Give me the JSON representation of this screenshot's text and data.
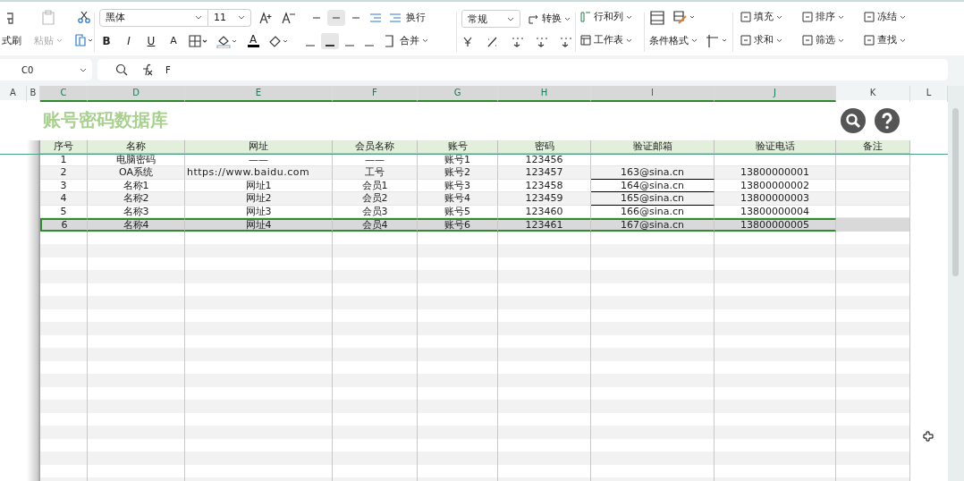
{
  "ribbon": {
    "clipboard": {
      "format_painter": "式刷",
      "paste": "粘贴"
    },
    "font": {
      "family": "黑体",
      "size": "11",
      "bold": "B",
      "italic": "I",
      "underline": "U",
      "strike": "A",
      "font_color": "A"
    },
    "alignment": {
      "wrap": "换行",
      "merge": "合并"
    },
    "number": {
      "format": "常规",
      "convert": "转换"
    },
    "cells": {
      "rows_cols": "行和列",
      "sheet": "工作表",
      "conditional": "条件格式"
    },
    "editing": [
      {
        "label": "填充"
      },
      {
        "label": "排序"
      },
      {
        "label": "冻结"
      },
      {
        "label": "求和"
      },
      {
        "label": "筛选"
      },
      {
        "label": "查找"
      }
    ]
  },
  "formula_bar": {
    "cell_ref": "C0",
    "formula": "F"
  },
  "column_headers": [
    {
      "label": "A",
      "selected": false
    },
    {
      "label": "B",
      "selected": false
    },
    {
      "label": "C",
      "selected": true
    },
    {
      "label": "D",
      "selected": true
    },
    {
      "label": "E",
      "selected": true
    },
    {
      "label": "F",
      "selected": true
    },
    {
      "label": "G",
      "selected": true
    },
    {
      "label": "H",
      "selected": true
    },
    {
      "label": "I",
      "selected": true
    },
    {
      "label": "J",
      "selected": true
    },
    {
      "label": "K",
      "selected": false
    },
    {
      "label": "L",
      "selected": false
    }
  ],
  "sheet_title": "账号密码数据库",
  "table": {
    "columns": [
      {
        "label": "序号"
      },
      {
        "label": "名称"
      },
      {
        "label": "网址"
      },
      {
        "label": "会员名称"
      },
      {
        "label": "账号"
      },
      {
        "label": "密码"
      },
      {
        "label": "验证邮箱"
      },
      {
        "label": "验证电话"
      },
      {
        "label": "备注"
      }
    ],
    "rows": [
      {
        "no": "1",
        "name": "电脑密码",
        "url": "——",
        "member": "——",
        "account": "账号1",
        "password": "123456",
        "email_underlined": false,
        "selected": false
      },
      {
        "no": "2",
        "name": "OA系统",
        "url": "https://www.baidu.com",
        "member": "工号",
        "account": "账号2",
        "password": "123457",
        "email": "163@sina.cn",
        "phone": "13800000001",
        "email_underlined": true,
        "selected": false
      },
      {
        "no": "3",
        "name": "名称1",
        "url": "网址1",
        "member": "会员1",
        "account": "账号3",
        "password": "123458",
        "email": "164@sina.cn",
        "phone": "13800000002",
        "email_underlined": true,
        "selected": false
      },
      {
        "no": "4",
        "name": "名称2",
        "url": "网址2",
        "member": "会员2",
        "account": "账号4",
        "password": "123459",
        "email": "165@sina.cn",
        "phone": "13800000003",
        "email_underlined": true,
        "selected": false
      },
      {
        "no": "5",
        "name": "名称3",
        "url": "网址3",
        "member": "会员3",
        "account": "账号5",
        "password": "123460",
        "email": "166@sina.cn",
        "phone": "13800000004",
        "email_underlined": false,
        "selected": false
      },
      {
        "no": "6",
        "name": "名称4",
        "url": "网址4",
        "member": "会员4",
        "account": "账号6",
        "password": "123461",
        "email": "167@sina.cn",
        "phone": "13800000005",
        "email_underlined": false,
        "selected": true
      }
    ]
  }
}
